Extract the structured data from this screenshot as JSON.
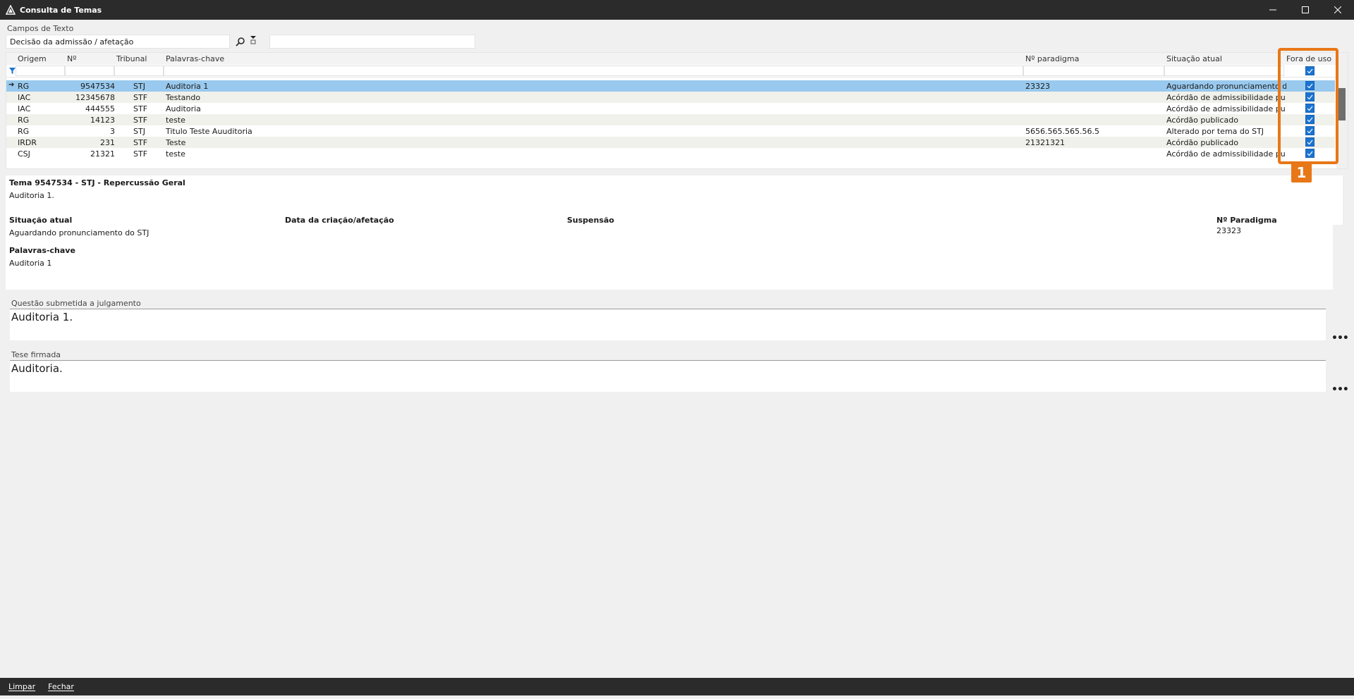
{
  "window": {
    "title": "Consulta de Temas"
  },
  "filters": {
    "campos_label": "Campos de Texto",
    "campos_value": "Decisão da admissão / afetação",
    "search_value": ""
  },
  "grid": {
    "columns": [
      "Origem",
      "Nº",
      "Tribunal",
      "Palavras-chave",
      "Nº paradigma",
      "Situação atual",
      "Fora de uso"
    ],
    "rows": [
      {
        "origem": "RG",
        "numero": "9547534",
        "tribunal": "STJ",
        "palavras": "Auditoria 1",
        "paradigma": "23323",
        "situacao": "Aguardando pronunciamento do",
        "fora_de_uso": true
      },
      {
        "origem": "IAC",
        "numero": "12345678",
        "tribunal": "STF",
        "palavras": "Testando",
        "paradigma": "",
        "situacao": "Acórdão de admissibilidade pu",
        "fora_de_uso": true
      },
      {
        "origem": "IAC",
        "numero": "444555",
        "tribunal": "STF",
        "palavras": "Auditoria",
        "paradigma": "",
        "situacao": "Acórdão de admissibilidade pu",
        "fora_de_uso": true
      },
      {
        "origem": "RG",
        "numero": "14123",
        "tribunal": "STF",
        "palavras": "teste",
        "paradigma": "",
        "situacao": "Acórdão publicado",
        "fora_de_uso": true
      },
      {
        "origem": "RG",
        "numero": "3",
        "tribunal": "STJ",
        "palavras": "Titulo Teste Auuditoria",
        "paradigma": "5656.565.565.56.5",
        "situacao": "Alterado por tema do STJ",
        "fora_de_uso": true
      },
      {
        "origem": "IRDR",
        "numero": "231",
        "tribunal": "STF",
        "palavras": "Teste",
        "paradigma": "21321321",
        "situacao": "Acórdão publicado",
        "fora_de_uso": true
      },
      {
        "origem": "CSJ",
        "numero": "21321",
        "tribunal": "STF",
        "palavras": "teste",
        "paradigma": "",
        "situacao": "Acórdão de admissibilidade pu",
        "fora_de_uso": true
      }
    ],
    "selected_index": 0
  },
  "detail": {
    "heading": "Tema 9547534 - STJ - Repercussão Geral",
    "subtitle": "Auditoria 1.",
    "situacao_label": "Situação atual",
    "situacao_value": "Aguardando pronunciamento do STJ",
    "data_label": "Data da criação/afetação",
    "suspensao_label": "Suspensão",
    "paradigma_label": "Nº Paradigma",
    "paradigma_value": "23323",
    "palavras_label": "Palavras-chave",
    "palavras_value": "Auditoria 1"
  },
  "questao": {
    "label": "Questão submetida a julgamento",
    "value": "Auditoria 1."
  },
  "tese": {
    "label": "Tese firmada",
    "value": "Auditoria."
  },
  "footer": {
    "limpar": "Limpar",
    "fechar": "Fechar"
  },
  "annotation": {
    "badge": "1"
  },
  "colors": {
    "selection": "#99c9ee",
    "checkbox": "#1a73d1",
    "callout": "#e87717",
    "chrome": "#2b2b2b"
  }
}
